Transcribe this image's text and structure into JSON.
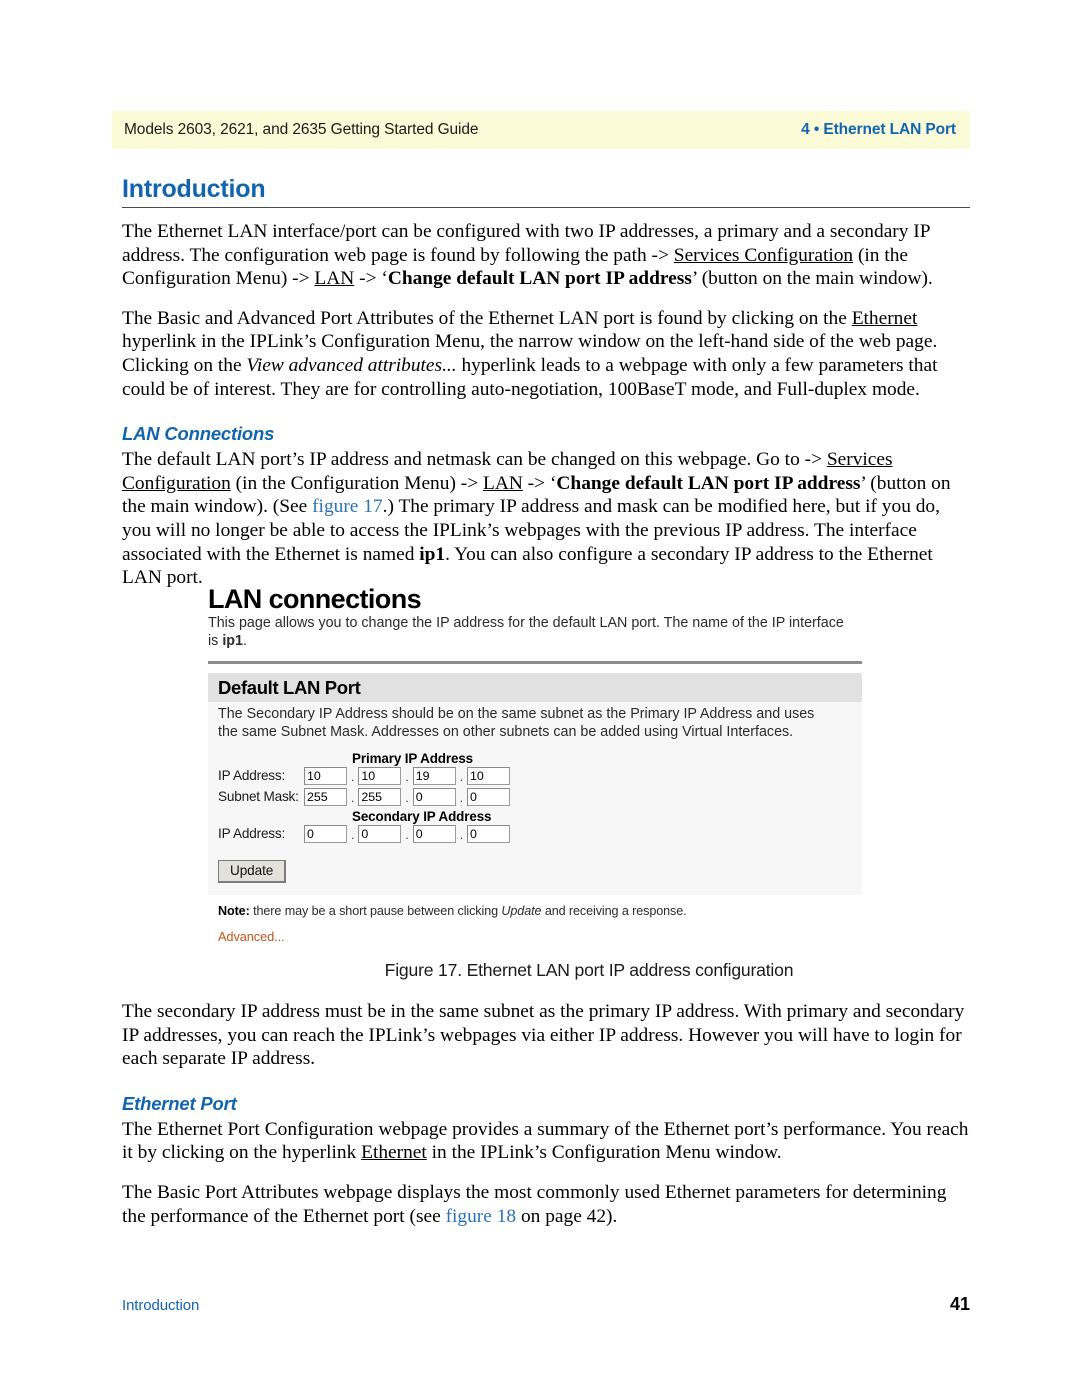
{
  "header": {
    "left": "Models 2603, 2621, and 2635 Getting Started Guide",
    "right": "4 • Ethernet LAN Port"
  },
  "chapter": {
    "heading": "Introduction"
  },
  "paragraphs": {
    "intro_1": {
      "seg_1": "The Ethernet LAN interface/port can be configured with two IP addresses, a primary and a secondary IP address. The configuration web page is found by following the path -> ",
      "link_1": "Services Configuration",
      "seg_2": " (in the Configuration Menu) -> ",
      "link_2": "LAN",
      "seg_3": " -> ‘",
      "bold_1": "Change default LAN port IP address",
      "seg_4": "’ (button on the main window)."
    },
    "intro_2": {
      "seg_1": "The Basic and Advanced Port Attributes of the Ethernet LAN port is found by clicking on the ",
      "link_1": "Ethernet",
      "seg_2": " hyperlink in the IPLink’s Configuration Menu, the narrow window on the left-hand side of the web page. Clicking on the ",
      "italic_1": "View advanced attributes...",
      "seg_3": " hyperlink leads to a webpage with only a few parameters that could be of interest. They are for controlling auto-negotiation, 100BaseT mode, and Full-duplex mode."
    },
    "lan_conn": {
      "seg_1": "The default LAN port’s IP address and netmask can be changed on this webpage. Go to -> ",
      "link_1": "Services Configuration",
      "seg_2": " (in the Configuration Menu) -> ",
      "link_2": "LAN",
      "seg_3": " -> ‘",
      "bold_1": "Change default LAN port IP address",
      "seg_4": "’ (button on the main window). (See ",
      "xref_1": "figure 17",
      "seg_5": ".) The primary IP address and mask can be modified here, but if you do, you will no longer be able to access the IPLink’s webpages with the previous IP address. The interface associated with the Ethernet is named ",
      "bold_2": "ip1",
      "seg_6": ". You can also configure a secondary IP address to the Ethernet LAN port."
    },
    "after_figure": "The secondary IP address must be in the same subnet as the primary IP address. With primary and secondary IP addresses, you can reach the IPLink’s webpages via either IP address. However you will have to login for each separate IP address.",
    "eth_port_1": {
      "seg_1": "The Ethernet Port Configuration webpage provides a summary of the Ethernet port’s performance. You reach it by clicking on the hyperlink ",
      "link_1": "Ethernet",
      "seg_2": " in the IPLink’s Configuration Menu window."
    },
    "eth_port_2": {
      "seg_1": "The Basic Port Attributes webpage displays the most commonly used Ethernet parameters for determining the performance of the Ethernet port (see ",
      "xref_1": "figure 18",
      "seg_2": " on page 42)."
    }
  },
  "subheadings": {
    "lan_connections": "LAN Connections",
    "ethernet_port": "Ethernet Port"
  },
  "figure": {
    "caption": "Figure 17. Ethernet LAN port IP address configuration",
    "screenshot": {
      "title": "LAN connections",
      "intro_before": "This page allows you to change the IP address for the default LAN port. The name of the IP interface is ",
      "intro_bold": "ip1",
      "intro_after": ".",
      "panel_title": "Default LAN Port",
      "panel_desc": "The Secondary IP Address should be on the same subnet as the Primary IP Address and uses the same Subnet Mask. Addresses on other subnets can be added using Virtual Interfaces.",
      "primary_group_title": "Primary IP Address",
      "secondary_group_title": "Secondary IP Address",
      "rows": [
        {
          "label": "IP Address:",
          "octets": [
            "10",
            "10",
            "19",
            "10"
          ]
        },
        {
          "label": "Subnet Mask:",
          "octets": [
            "255",
            "255",
            "0",
            "0"
          ]
        },
        {
          "label": "IP Address:",
          "octets": [
            "0",
            "0",
            "0",
            "0"
          ]
        }
      ],
      "update_button": "Update",
      "note": {
        "bold": "Note:",
        "seg_1": " there may be a short pause between clicking ",
        "italic": "Update",
        "seg_2": " and receiving a response."
      },
      "advanced_link": "Advanced...",
      "colors": {
        "panel_header_bg": "#e1e1e1",
        "panel_bg": "#f7f7f8",
        "link": "#c1551b",
        "rule": "#8d8d8d"
      }
    }
  },
  "footer": {
    "left": "Introduction",
    "page_number": "41"
  },
  "theme": {
    "header_band": "#fcfbd8",
    "accent_blue": "#1165b0",
    "xref_blue": "#2a72b5"
  }
}
